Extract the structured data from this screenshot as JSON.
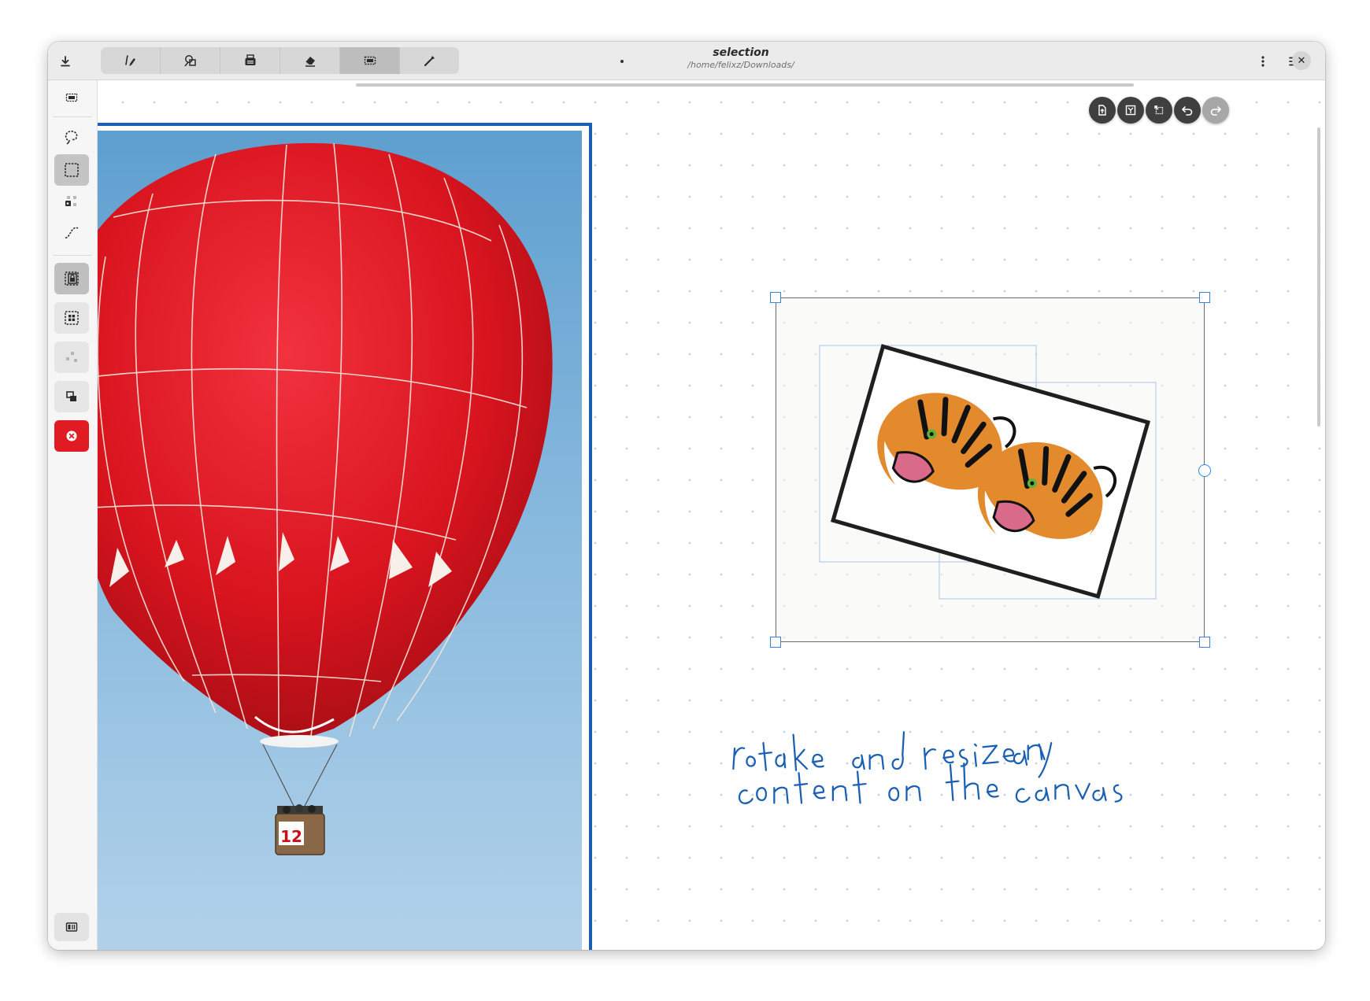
{
  "window": {
    "title": "selection",
    "subtitle": "/home/felixz/Downloads/"
  },
  "header": {
    "left_button_icon": "download-icon",
    "tool_tabs": [
      {
        "icon": "pen-icon",
        "active": false
      },
      {
        "icon": "shapes-icon",
        "active": false
      },
      {
        "icon": "typewriter-icon",
        "active": false
      },
      {
        "icon": "eraser-icon",
        "active": false
      },
      {
        "icon": "selector-icon",
        "active": true
      },
      {
        "icon": "tools-icon",
        "active": false
      }
    ],
    "right_buttons": [
      "more-vertical-icon",
      "menu-icon",
      "close-icon"
    ],
    "close_glyph": "✕"
  },
  "sidebar": {
    "top_icon": "selector-mode-icon",
    "modes": [
      "lasso-icon",
      "rectangle-select-icon",
      "single-select-icon",
      "intersect-select-icon"
    ],
    "active_mode": "rectangle-select-icon",
    "actions": [
      "resize-lock-icon",
      "select-all-icon",
      "select-none-icon",
      "duplicate-icon",
      "delete-icon"
    ],
    "bottom_icon": "sidebar-toggle-icon"
  },
  "canvas": {
    "float_buttons": [
      {
        "icon": "export-icon",
        "enabled": true
      },
      {
        "icon": "zoom-fit-icon",
        "enabled": true
      },
      {
        "icon": "magic-icon",
        "enabled": true
      },
      {
        "icon": "undo-icon",
        "enabled": true
      },
      {
        "icon": "redo-icon",
        "enabled": false
      }
    ],
    "balloon_number": "12",
    "handwriting": {
      "line1": "rotate and resize any",
      "line2": "content on the canvas",
      "color": "#1a5fb4"
    },
    "selection_handle_color": "#3584e4",
    "frame_color": "#1a5fb4"
  }
}
